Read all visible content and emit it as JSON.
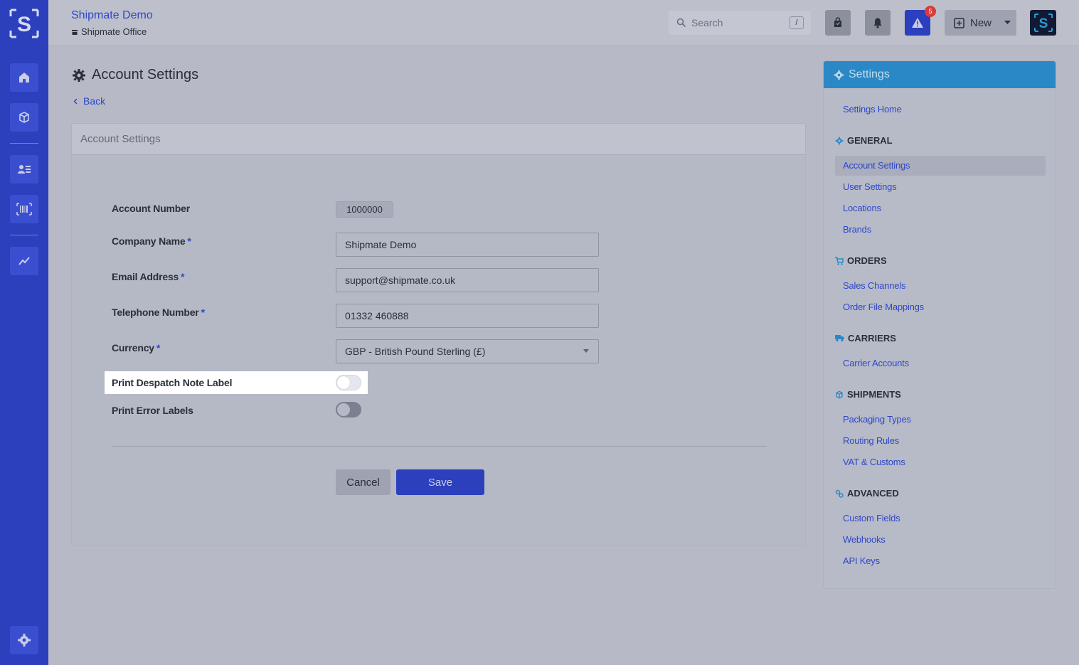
{
  "header": {
    "title": "Shipmate Demo",
    "subtitle": "Shipmate Office",
    "search_placeholder": "Search",
    "search_shortcut": "/",
    "alert_count": "5",
    "new_label": "New"
  },
  "page": {
    "title": "Account Settings",
    "back_label": "Back"
  },
  "form": {
    "card_title": "Account Settings",
    "account_number_label": "Account Number",
    "account_number_value": "1000000",
    "company_name_label": "Company Name",
    "company_name_value": "Shipmate Demo",
    "email_label": "Email Address",
    "email_value": "support@shipmate.co.uk",
    "telephone_label": "Telephone Number",
    "telephone_value": "01332 460888",
    "currency_label": "Currency",
    "currency_value": "GBP - British Pound Sterling (£)",
    "despatch_label": "Print Despatch Note Label",
    "despatch_enabled": false,
    "error_labels_label": "Print Error Labels",
    "error_labels_enabled": false,
    "required_marker": "*",
    "cancel_label": "Cancel",
    "save_label": "Save"
  },
  "settings_nav": {
    "title": "Settings",
    "home": "Settings Home",
    "general": {
      "heading": "GENERAL",
      "items": [
        "Account Settings",
        "User Settings",
        "Locations",
        "Brands"
      ]
    },
    "orders": {
      "heading": "ORDERS",
      "items": [
        "Sales Channels",
        "Order File Mappings"
      ]
    },
    "carriers": {
      "heading": "CARRIERS",
      "items": [
        "Carrier Accounts"
      ]
    },
    "shipments": {
      "heading": "SHIPMENTS",
      "items": [
        "Packaging Types",
        "Routing Rules",
        "VAT & Customs"
      ]
    },
    "advanced": {
      "heading": "ADVANCED",
      "items": [
        "Custom Fields",
        "Webhooks",
        "API Keys"
      ]
    }
  },
  "colors": {
    "primary": "#2c3fbd",
    "panel_header": "#2a88c6",
    "badge": "#d63d3d"
  },
  "icons": {
    "sidebar": [
      "home-icon",
      "box-icon",
      "contacts-icon",
      "barcode-icon",
      "chart-icon",
      "gear-icon"
    ],
    "topbar": [
      "search-icon",
      "bag-icon",
      "bell-icon",
      "alert-icon",
      "plus-square-icon",
      "chevron-down-icon"
    ]
  }
}
